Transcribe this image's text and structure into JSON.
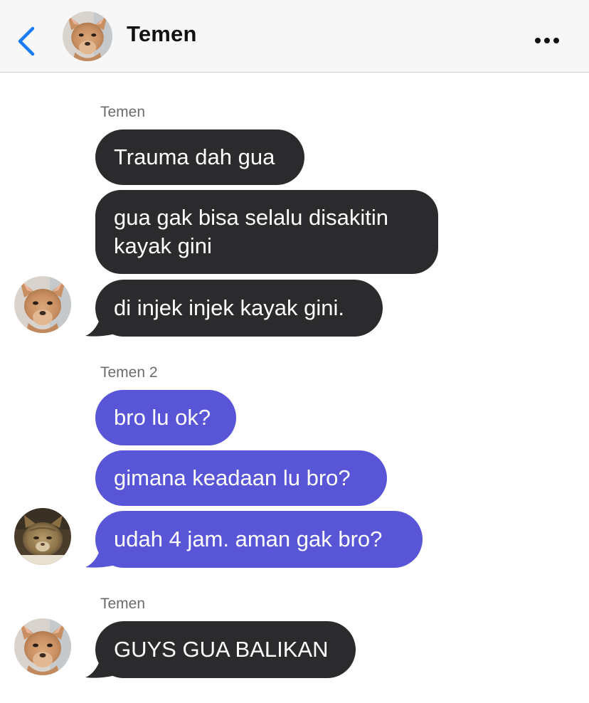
{
  "header": {
    "title": "Temen",
    "back_icon": "chevron-left-icon",
    "more_icon": "ellipsis-icon",
    "accent_color": "#1a7cf0"
  },
  "colors": {
    "dark_bubble": "#2b2b2d",
    "purple_bubble": "#5856d6",
    "sender_label": "#6b6b6b"
  },
  "groups": [
    {
      "sender": "Temen",
      "avatar": "chihuahua-avatar",
      "messages": [
        {
          "text": "Trauma dah gua"
        },
        {
          "text": "gua gak bisa selalu disakitin kayak gini"
        },
        {
          "text": "di injek injek kayak gini."
        }
      ]
    },
    {
      "sender": "Temen 2",
      "avatar": "cat-avatar",
      "messages": [
        {
          "text": "bro lu ok?"
        },
        {
          "text": "gimana keadaan lu bro?"
        },
        {
          "text": "udah 4 jam. aman gak bro?"
        }
      ]
    },
    {
      "sender": "Temen",
      "avatar": "chihuahua-avatar",
      "messages": [
        {
          "text": "GUYS GUA BALIKAN"
        }
      ]
    }
  ]
}
